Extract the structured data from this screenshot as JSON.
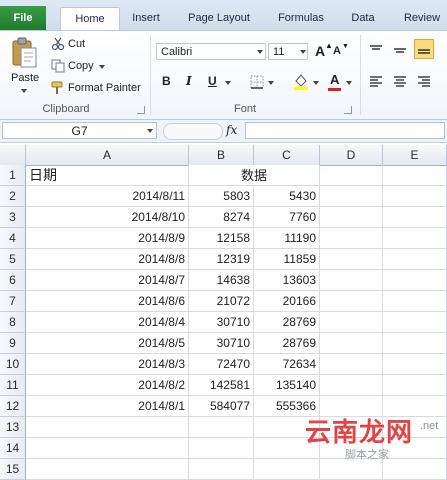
{
  "tabs": [
    "File",
    "Home",
    "Insert",
    "Page Layout",
    "Formulas",
    "Data",
    "Review"
  ],
  "clipboard": {
    "paste_label": "Paste",
    "cut_label": "Cut",
    "copy_label": "Copy",
    "format_painter_label": "Format Painter",
    "group_label": "Clipboard"
  },
  "font": {
    "name": "Calibri",
    "size": "11",
    "bold": "B",
    "italic": "I",
    "underline": "U",
    "grow": "A",
    "shrink": "A",
    "font_color": "A",
    "group_label": "Font"
  },
  "formula_bar": {
    "name_box": "G7",
    "fx": "fx",
    "value": ""
  },
  "columns": [
    "A",
    "B",
    "C",
    "D",
    "E"
  ],
  "rows": [
    {
      "n": "1",
      "a": "日期",
      "b": "数据",
      "c": ""
    },
    {
      "n": "2",
      "a": "2014/8/11",
      "b": "5803",
      "c": "5430"
    },
    {
      "n": "3",
      "a": "2014/8/10",
      "b": "8274",
      "c": "7760"
    },
    {
      "n": "4",
      "a": "2014/8/9",
      "b": "12158",
      "c": "11190"
    },
    {
      "n": "5",
      "a": "2014/8/8",
      "b": "12319",
      "c": "11859"
    },
    {
      "n": "6",
      "a": "2014/8/7",
      "b": "14638",
      "c": "13603"
    },
    {
      "n": "7",
      "a": "2014/8/6",
      "b": "21072",
      "c": "20166"
    },
    {
      "n": "8",
      "a": "2014/8/4",
      "b": "30710",
      "c": "28769"
    },
    {
      "n": "9",
      "a": "2014/8/5",
      "b": "30710",
      "c": "28769"
    },
    {
      "n": "10",
      "a": "2014/8/3",
      "b": "72470",
      "c": "72634"
    },
    {
      "n": "11",
      "a": "2014/8/2",
      "b": "142581",
      "c": "135140"
    },
    {
      "n": "12",
      "a": "2014/8/1",
      "b": "584077",
      "c": "555366"
    },
    {
      "n": "13",
      "a": "",
      "b": "",
      "c": ""
    },
    {
      "n": "14",
      "a": "",
      "b": "",
      "c": ""
    },
    {
      "n": "15",
      "a": "",
      "b": "",
      "c": ""
    }
  ],
  "watermark": {
    "main": "云南龙网",
    "net": ".net",
    "sub": "脚本之家"
  }
}
